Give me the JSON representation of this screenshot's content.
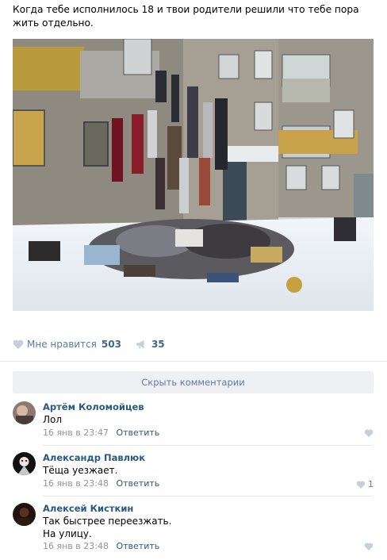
{
  "post": {
    "text": "Когда тебе исполнилось 18 и твои родители решили что тебе пора жить отдельно."
  },
  "actions": {
    "like_label": "Мне нравится",
    "like_count": "503",
    "share_count": "35"
  },
  "comments_toggle": "Скрыть комментарии",
  "comments": [
    {
      "author": "Артём Коломойцев",
      "text": "Лол",
      "date": "16 янв в 23:47",
      "reply": "Ответить",
      "likes": ""
    },
    {
      "author": "Александр Павлюк",
      "text": "Тёща уезжает.",
      "date": "16 янв в 23:48",
      "reply": "Ответить",
      "likes": "1"
    },
    {
      "author": "Алексей Кисткин",
      "text_line1": "Так быстрее переезжать.",
      "text_line2": "На улицу.",
      "date": "16 янв в 23:48",
      "reply": "Ответить",
      "likes": ""
    }
  ],
  "colors": {
    "link": "#2a5885",
    "muted": "#939393",
    "icon": "#c5d0db",
    "divider": "#e7e8ec"
  },
  "icons": [
    "heart-icon",
    "megaphone-icon"
  ]
}
